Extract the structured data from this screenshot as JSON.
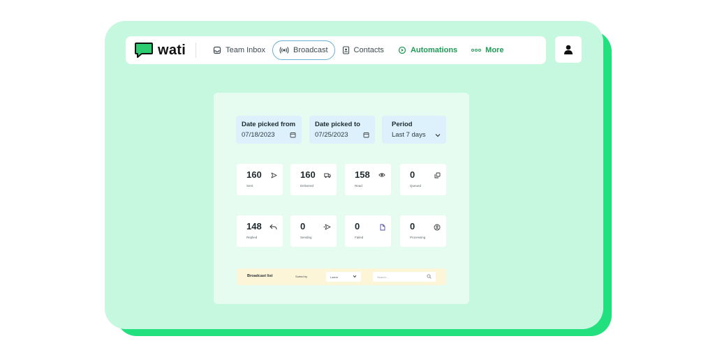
{
  "app": {
    "logo_text": "wati"
  },
  "nav": {
    "items": [
      {
        "label": "Team Inbox",
        "icon": "inbox-icon"
      },
      {
        "label": "Broadcast",
        "icon": "broadcast-icon",
        "active": true
      },
      {
        "label": "Contacts",
        "icon": "contacts-icon"
      },
      {
        "label": "Automations",
        "icon": "automations-icon",
        "accent": true
      },
      {
        "label": "More",
        "icon": "more-icon",
        "accent": true
      }
    ]
  },
  "user": {
    "icon": "user-icon"
  },
  "filters": {
    "date_from": {
      "label": "Date picked from",
      "value": "07/18/2023",
      "icon": "calendar-icon"
    },
    "date_to": {
      "label": "Date picked to",
      "value": "07/25/2023",
      "icon": "calendar-icon"
    },
    "period": {
      "label": "Period",
      "value": "Last 7 days",
      "icon": "chevron-down-icon"
    }
  },
  "stats": [
    {
      "value": "160",
      "label": "Sent",
      "icon": "send-icon"
    },
    {
      "value": "160",
      "label": "Delivered",
      "icon": "truck-icon"
    },
    {
      "value": "158",
      "label": "Read",
      "icon": "eye-icon"
    },
    {
      "value": "0",
      "label": "Queued",
      "icon": "queue-icon"
    },
    {
      "value": "148",
      "label": "Replied",
      "icon": "reply-icon"
    },
    {
      "value": "0",
      "label": "Sending",
      "icon": "sending-icon"
    },
    {
      "value": "0",
      "label": "Failed",
      "icon": "failed-icon"
    },
    {
      "value": "0",
      "label": "Processing",
      "icon": "processing-icon"
    }
  ],
  "broadcast_list": {
    "title": "Broadcast list",
    "sort_label": "Sorted by",
    "sort_value": "Latest",
    "search_placeholder": "Search..."
  },
  "colors": {
    "accent_green": "#22e07e",
    "card_bg": "#c6f8e0",
    "active_border": "#6aaed0",
    "nav_accent": "#1e9b55"
  }
}
